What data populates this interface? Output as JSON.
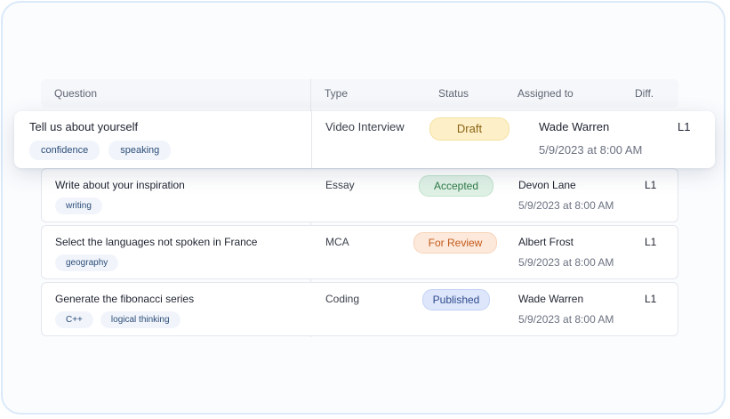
{
  "columns": {
    "question": "Question",
    "type": "Type",
    "status": "Status",
    "assigned_to": "Assigned to",
    "difficulty": "Diff."
  },
  "highlighted_row": {
    "question": "Tell us about yourself",
    "tags": [
      "confidence",
      "speaking"
    ],
    "type": "Video Interview",
    "status": "Draft",
    "assignee": "Wade Warren",
    "date": "5/9/2023 at 8:00 AM",
    "difficulty": "L1"
  },
  "rows": [
    {
      "question": "Write about your inspiration",
      "tags": [
        "writing"
      ],
      "type": "Essay",
      "status": "Accepted",
      "assignee": "Devon Lane",
      "date": "5/9/2023 at 8:00 AM",
      "difficulty": "L1"
    },
    {
      "question": "Select the languages not spoken in France",
      "tags": [
        "geography"
      ],
      "type": "MCA",
      "status": "For Review",
      "assignee": "Albert Frost",
      "date": "5/9/2023 at 8:00 AM",
      "difficulty": "L1"
    },
    {
      "question": "Generate the fibonacci series",
      "tags": [
        "C++",
        "logical thinking"
      ],
      "type": "Coding",
      "status": "Published",
      "assignee": "Wade Warren",
      "date": "5/9/2023 at 8:00 AM",
      "difficulty": "L1"
    }
  ],
  "status_colors": {
    "Draft": "#fdf0c8",
    "Accepted": "#dff1e5",
    "For Review": "#fde9db",
    "Published": "#dde6fa"
  }
}
